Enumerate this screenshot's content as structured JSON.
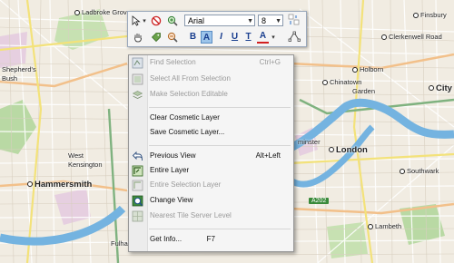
{
  "map": {
    "labels": {
      "ladbroke_grove": "Ladbroke Grove",
      "finsbury": "Finsbury",
      "clerkenwell": "Clerkenwell Road",
      "holborn": "Holborn",
      "chinatown": "Chinatown",
      "garden": "Garden",
      "city": "City",
      "shepherds": "Shepherd's",
      "bush": "Bush",
      "westminster": "minster",
      "london": "London",
      "west_kensington_1": "West",
      "west_kensington_2": "Kensington",
      "hammersmith": "Hammersmith",
      "southwark": "Southwark",
      "lambeth": "Lambeth",
      "fulham": "Fulham",
      "a202": "A202"
    }
  },
  "toolbar": {
    "font_name": "Arial",
    "font_size": "8",
    "bold": "B",
    "highlight": "A",
    "italic": "I",
    "underline": "U",
    "subscript": "T",
    "font_color": "A",
    "colors": {
      "bold": "#1a3f8f",
      "font_color": "#d22020",
      "highlight_bg": "#9cc4ea"
    }
  },
  "context_menu": {
    "items": [
      {
        "label": "Find Selection",
        "shortcut": "Ctrl+G",
        "enabled": false,
        "icon": "find-selection-icon"
      },
      {
        "label": "Select All From Selection",
        "shortcut": "",
        "enabled": false,
        "icon": "select-all-icon"
      },
      {
        "label": "Make Selection Editable",
        "shortcut": "",
        "enabled": false,
        "icon": "layers-icon"
      },
      {
        "label": "Clear Cosmetic Layer",
        "shortcut": "",
        "enabled": true,
        "icon": ""
      },
      {
        "label": "Save Cosmetic Layer...",
        "shortcut": "",
        "enabled": true,
        "icon": ""
      },
      {
        "label": "Previous View",
        "shortcut": "Alt+Left",
        "enabled": true,
        "icon": "back-arrow-icon"
      },
      {
        "label": "Entire Layer",
        "shortcut": "",
        "enabled": true,
        "icon": "entire-layer-icon"
      },
      {
        "label": "Entire Selection Layer",
        "shortcut": "",
        "enabled": false,
        "icon": "entire-selection-icon"
      },
      {
        "label": "Change View",
        "shortcut": "",
        "enabled": true,
        "icon": "change-view-icon"
      },
      {
        "label": "Nearest Tile Server Level",
        "shortcut": "",
        "enabled": false,
        "icon": "tile-server-icon"
      },
      {
        "label": "Get Info...",
        "shortcut": "F7",
        "enabled": true,
        "icon": ""
      }
    ]
  }
}
